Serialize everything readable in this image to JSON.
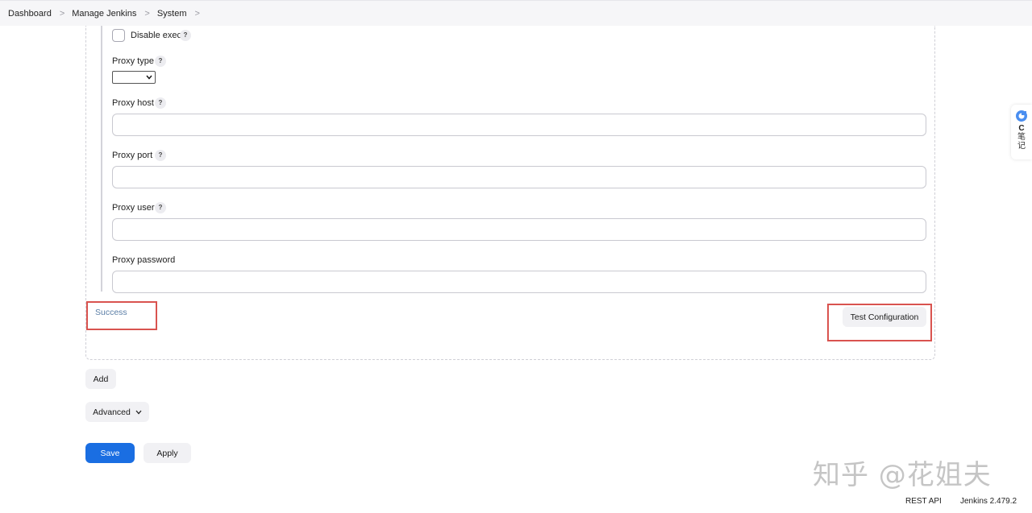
{
  "breadcrumb": {
    "items": [
      "Dashboard",
      "Manage Jenkins",
      "System"
    ],
    "separator": ">"
  },
  "form": {
    "disable_exec_label": "Disable exec",
    "disable_exec_checked": false,
    "proxy_type_label": "Proxy type",
    "proxy_type_value": "",
    "proxy_host_label": "Proxy host",
    "proxy_host_value": "",
    "proxy_port_label": "Proxy port",
    "proxy_port_value": "",
    "proxy_user_label": "Proxy user",
    "proxy_user_value": "",
    "proxy_password_label": "Proxy password",
    "proxy_password_value": "",
    "help_glyph": "?"
  },
  "status": {
    "message": "Success",
    "color": "#5b7ea6"
  },
  "buttons": {
    "test_configuration": "Test Configuration",
    "add": "Add",
    "advanced": "Advanced",
    "save": "Save",
    "apply": "Apply"
  },
  "side_panel": {
    "letter": "C",
    "text_line1": "笔",
    "text_line2": "记"
  },
  "watermark": "知乎 @花姐夫",
  "footer": {
    "rest_api": "REST API",
    "version": "Jenkins 2.479.2"
  },
  "colors": {
    "primary": "#1a6ee2",
    "highlight_box": "#d9534f"
  }
}
